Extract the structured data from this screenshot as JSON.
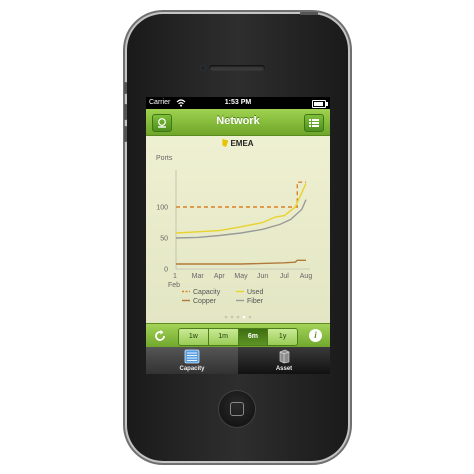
{
  "status": {
    "carrier": "Carrier",
    "time": "1:53 PM"
  },
  "navbar": {
    "title": "Network",
    "left_button_icon": "globe-icon",
    "right_button_icon": "list-icon"
  },
  "region": "EMEA",
  "chart_data": {
    "type": "line",
    "ylabel": "Ports",
    "yticks": [
      "100",
      "50",
      "0"
    ],
    "ylim": [
      0,
      150
    ],
    "xticks": [
      "1",
      "Mar",
      "Apr",
      "May",
      "Jun",
      "Jul",
      "Aug"
    ],
    "xtick_sub": "Feb",
    "series": [
      {
        "name": "Capacity",
        "color": "#d9822b",
        "style": "dashed",
        "points": [
          [
            0,
            100
          ],
          [
            1,
            100
          ],
          [
            2,
            100
          ],
          [
            3,
            100
          ],
          [
            4,
            100
          ],
          [
            5,
            100
          ],
          [
            5.6,
            100
          ],
          [
            5.6,
            140
          ],
          [
            6,
            140
          ]
        ]
      },
      {
        "name": "Used",
        "color": "#e8d32c",
        "style": "solid",
        "points": [
          [
            0,
            58
          ],
          [
            1,
            60
          ],
          [
            2,
            62
          ],
          [
            3,
            68
          ],
          [
            4,
            75
          ],
          [
            4.6,
            84
          ],
          [
            5,
            86
          ],
          [
            5.5,
            100
          ],
          [
            6,
            138
          ]
        ]
      },
      {
        "name": "Copper",
        "color": "#b07a3a",
        "style": "solid",
        "points": [
          [
            0,
            8
          ],
          [
            1,
            8
          ],
          [
            2,
            8
          ],
          [
            3,
            8
          ],
          [
            4,
            9
          ],
          [
            5,
            10
          ],
          [
            5.5,
            11
          ],
          [
            5.6,
            14
          ],
          [
            6,
            14
          ]
        ]
      },
      {
        "name": "Fiber",
        "color": "#9a9a9a",
        "style": "solid",
        "points": [
          [
            0,
            50
          ],
          [
            1,
            51
          ],
          [
            2,
            54
          ],
          [
            3,
            58
          ],
          [
            4,
            64
          ],
          [
            4.8,
            72
          ],
          [
            5.3,
            80
          ],
          [
            5.8,
            96
          ],
          [
            6,
            112
          ]
        ]
      }
    ],
    "legend": [
      "Capacity",
      "Used",
      "Copper",
      "Fiber"
    ]
  },
  "page_dots": {
    "count": 5,
    "active": 3
  },
  "toolbar": {
    "ranges": [
      "1w",
      "1m",
      "6m",
      "1y"
    ],
    "selected": "6m",
    "refresh_icon": "refresh-icon",
    "info_label": "i"
  },
  "tabs": [
    {
      "label": "Capacity",
      "icon": "capacity-icon",
      "active": true
    },
    {
      "label": "Asset",
      "icon": "asset-icon",
      "active": false
    }
  ],
  "colors": {
    "accent": "#7ab536",
    "background": "#e8ebc9"
  }
}
